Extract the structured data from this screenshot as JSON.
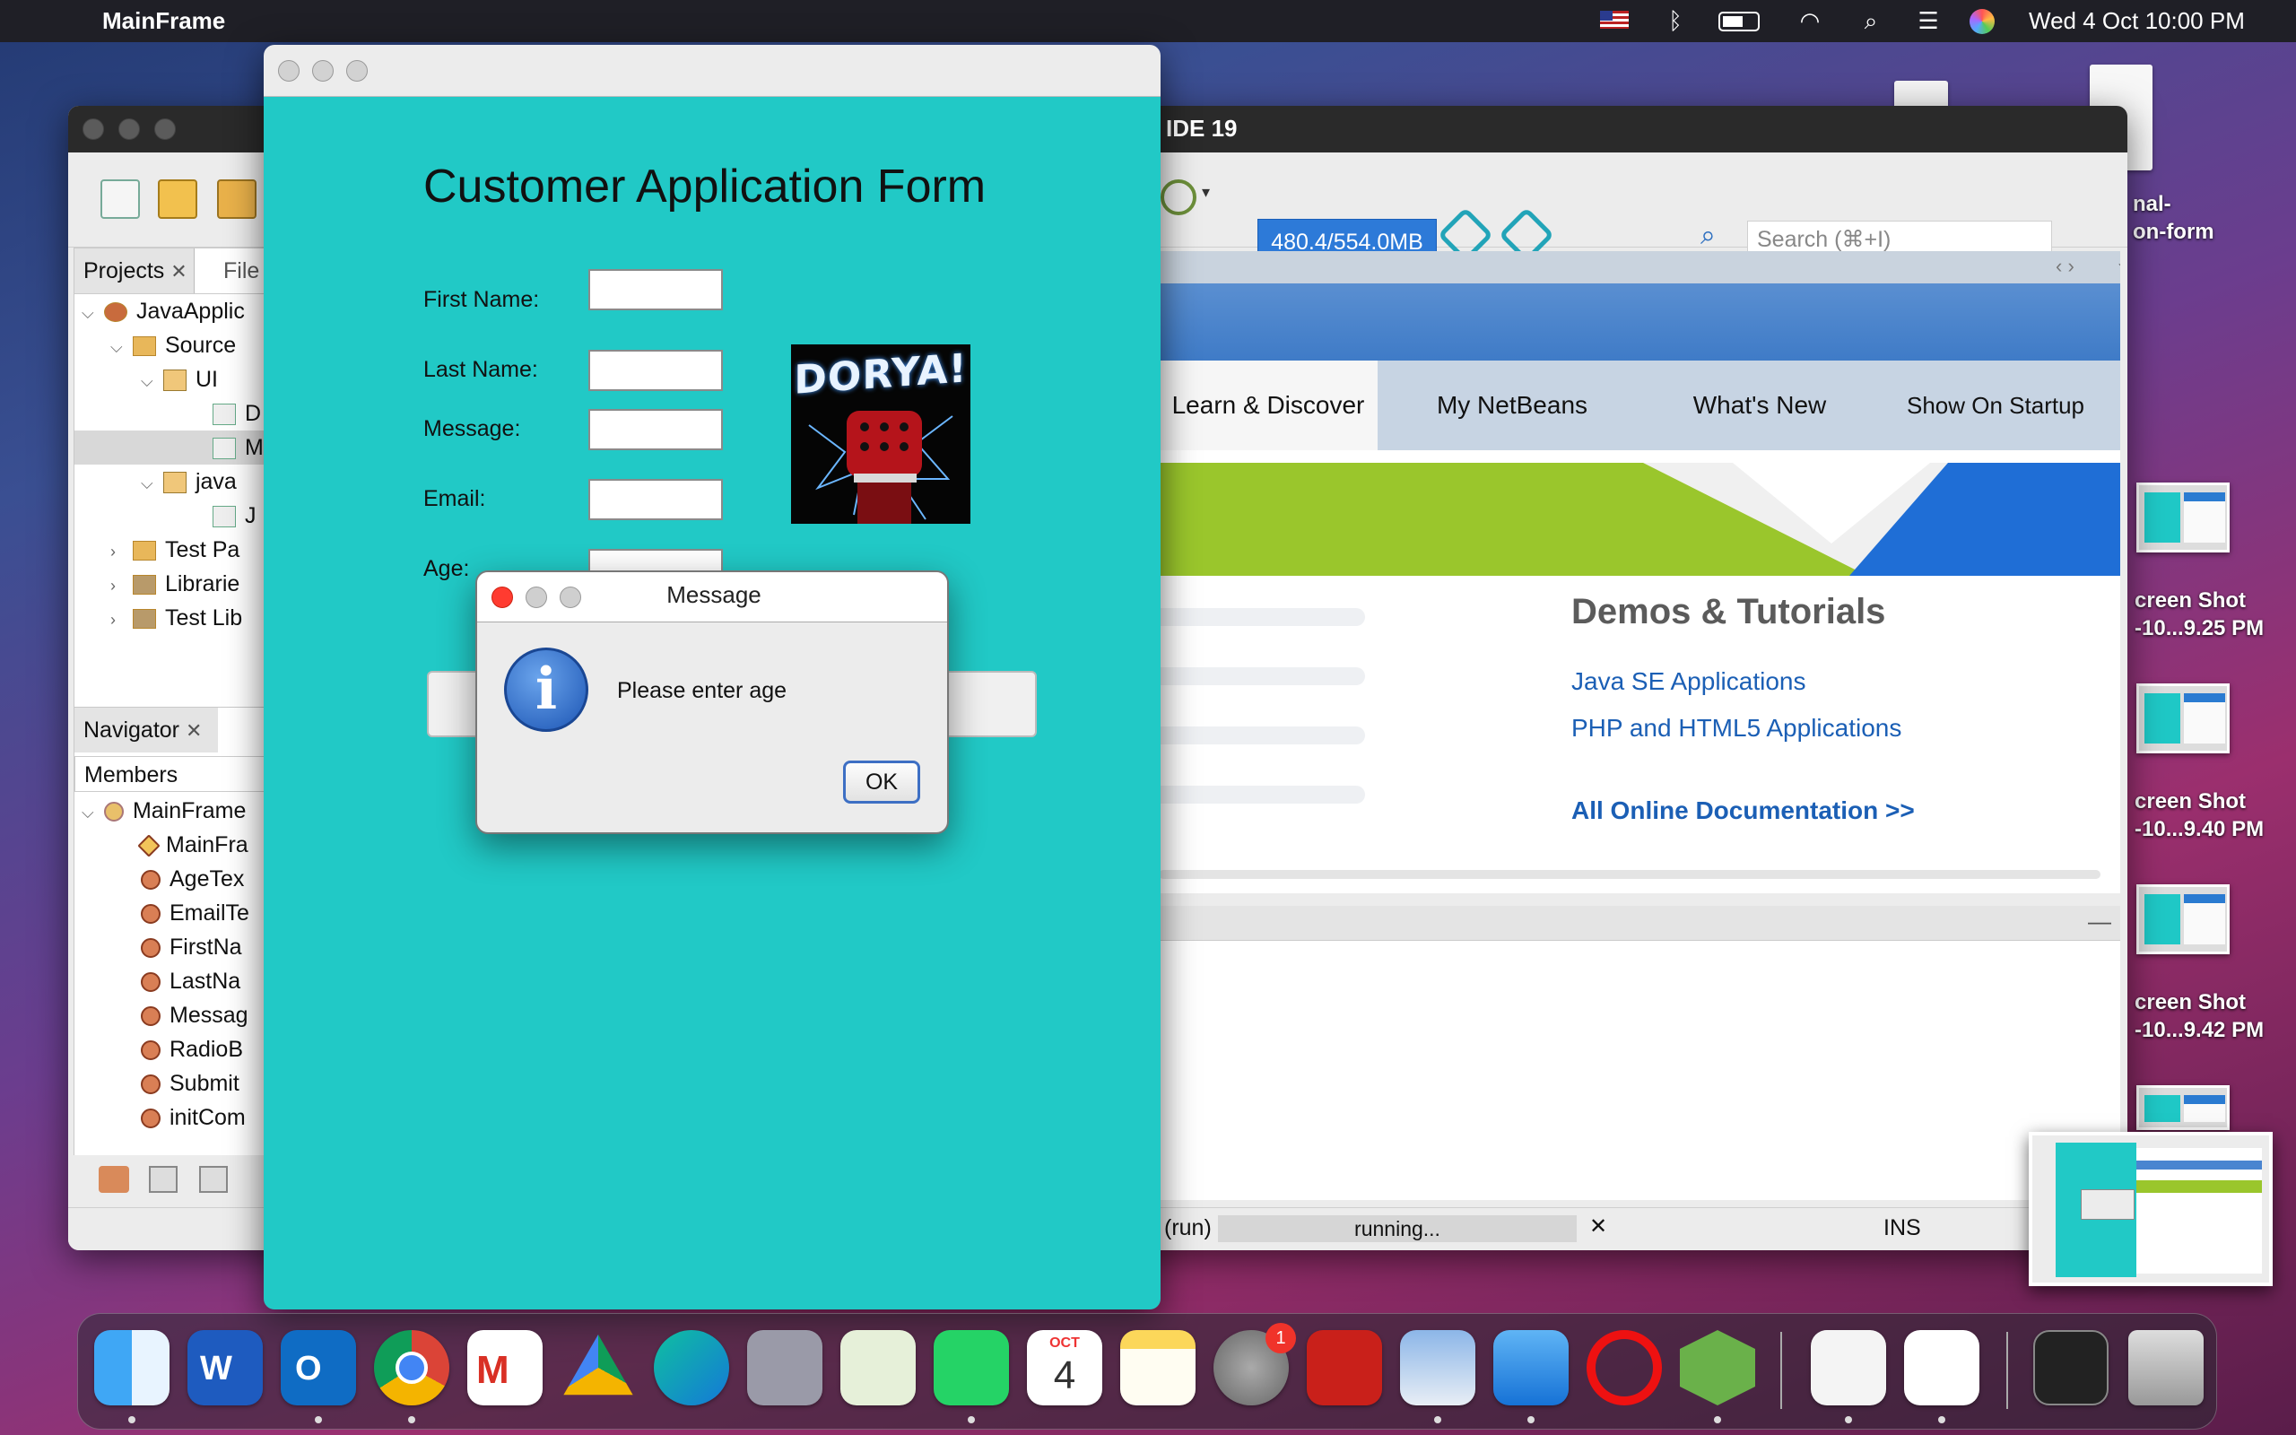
{
  "menubar": {
    "app_name": "MainFrame",
    "clock": "Wed 4 Oct  10:00 PM"
  },
  "desktop": {
    "side_file_label": [
      "nal-",
      "on-form"
    ],
    "screenshots": [
      {
        "line1": "creen Shot",
        "line2": "-10...9.25 PM"
      },
      {
        "line1": "creen Shot",
        "line2": "-10...9.40 PM"
      },
      {
        "line1": "creen Shot",
        "line2": "-10...9.42 PM"
      }
    ]
  },
  "netbeans": {
    "title": "IDE 19",
    "memory": "480.4/554.0MB",
    "search_placeholder": "Search (⌘+I)",
    "projects_tab": "Projects",
    "files_tab": "File",
    "tree": [
      "JavaApplic",
      "Source",
      "UI",
      "D",
      "M",
      "java",
      "J",
      "Test Pa",
      "Librarie",
      "Test Lib"
    ],
    "navigator_tab": "Navigator",
    "members_label": "Members",
    "members": [
      "MainFrame",
      "MainFra",
      "AgeTex",
      "EmailTe",
      "FirstNa",
      "LastNa",
      "Messag",
      "RadioB",
      "Submit",
      "initCom"
    ],
    "start_tabs": [
      "Learn & Discover",
      "My NetBeans",
      "What's New",
      "Show On Startup"
    ],
    "demos_title": "Demos & Tutorials",
    "links": [
      "Java SE Applications",
      "PHP and HTML5 Applications"
    ],
    "all_docs": "All Online Documentation >>",
    "status": {
      "run": "(run)",
      "progress": "running...",
      "mode": "INS"
    }
  },
  "form": {
    "heading": "Customer Application Form",
    "fields": [
      "First Name:",
      "Last Name:",
      "Message:",
      "Email:",
      "Age:"
    ],
    "logo_text": "DORYA!"
  },
  "dialog": {
    "title": "Message",
    "message": "Please enter age",
    "ok": "OK"
  },
  "dock": {
    "calendar_month": "OCT",
    "calendar_day": "4",
    "settings_badge": "1"
  },
  "colors": {
    "form_bg": "#21c9c6",
    "accent": "#2d7ad8",
    "link": "#1b5fb5"
  }
}
